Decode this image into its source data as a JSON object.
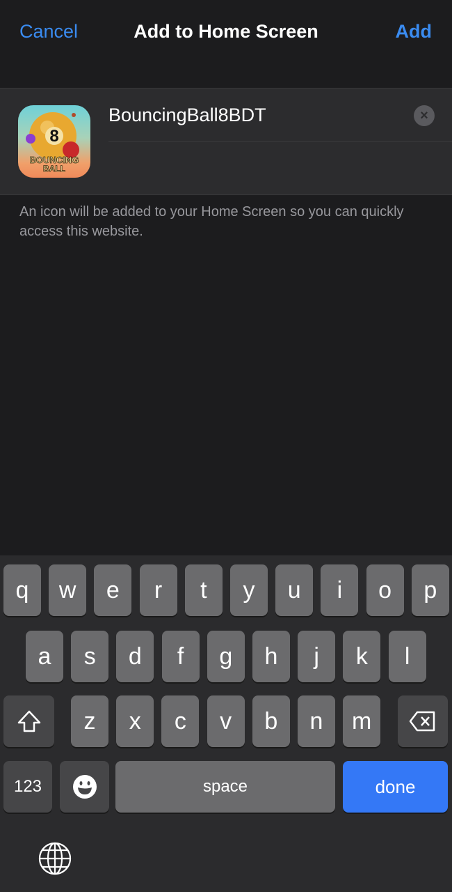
{
  "nav": {
    "cancel": "Cancel",
    "title": "Add to Home Screen",
    "add": "Add"
  },
  "app": {
    "name_value": "BouncingBall8BDT",
    "icon_text_line1": "BOUNCING",
    "icon_text_line2": "BALL"
  },
  "description": "An icon will be added to your Home Screen so you can quickly access this website.",
  "keyboard": {
    "row1": [
      "q",
      "w",
      "e",
      "r",
      "t",
      "y",
      "u",
      "i",
      "o",
      "p"
    ],
    "row2": [
      "a",
      "s",
      "d",
      "f",
      "g",
      "h",
      "j",
      "k",
      "l"
    ],
    "row3": [
      "z",
      "x",
      "c",
      "v",
      "b",
      "n",
      "m"
    ],
    "numbers": "123",
    "space": "space",
    "done": "done",
    "icons": {
      "shift": "shift-icon",
      "delete": "delete-icon",
      "emoji": "emoji-icon",
      "globe": "globe-icon"
    }
  },
  "colors": {
    "accent": "#3a8bf0",
    "done_key": "#3478f6"
  }
}
